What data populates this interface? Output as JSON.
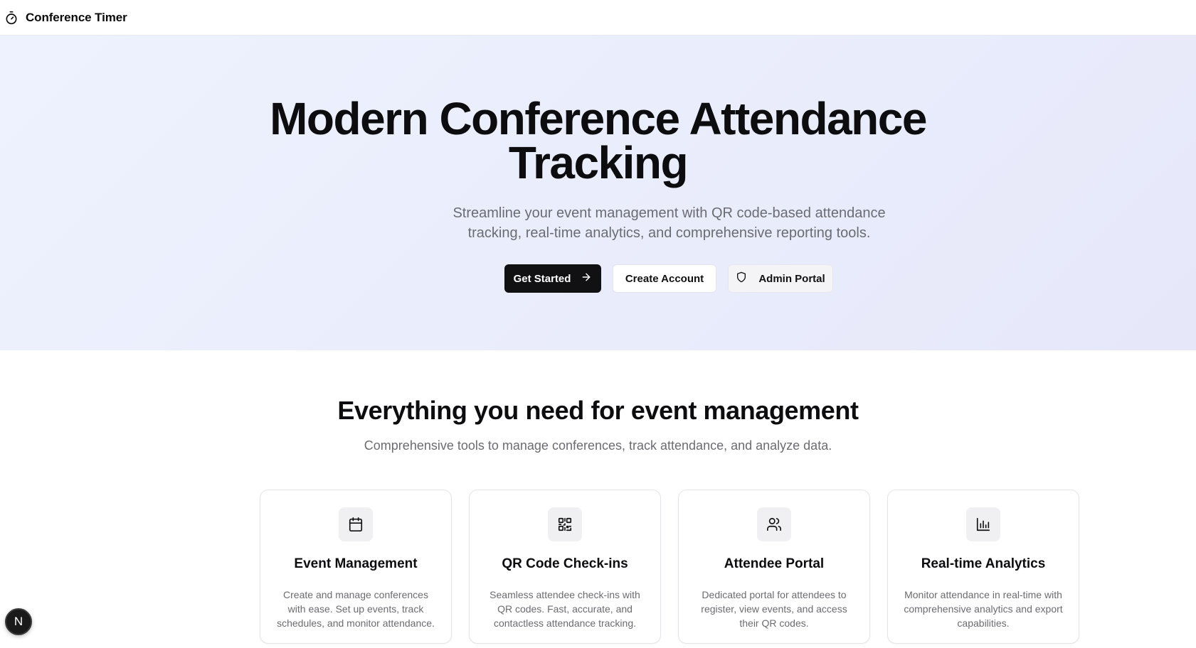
{
  "header": {
    "brand_icon": "stopwatch-icon",
    "brand_name": "Conference Timer"
  },
  "hero": {
    "title_line1": "Modern Conference Attendance",
    "title_line2": "Tracking",
    "subtitle_line1": "Streamline your event management with QR code-based attendance",
    "subtitle_line2": "tracking, real-time analytics, and comprehensive reporting tools.",
    "buttons": {
      "get_started": "Get Started",
      "create_account": "Create Account",
      "admin_portal": "Admin Portal"
    }
  },
  "features": {
    "title": "Everything you need for event management",
    "subtitle": "Comprehensive tools to manage conferences, track attendance, and analyze data.",
    "cards": [
      {
        "icon": "calendar-icon",
        "title": "Event Management",
        "desc": "Create and manage conferences with ease. Set up events, track schedules, and monitor attendance."
      },
      {
        "icon": "qr-code-icon",
        "title": "QR Code Check-ins",
        "desc": "Seamless attendee check-ins with QR codes. Fast, accurate, and contactless attendance tracking."
      },
      {
        "icon": "users-icon",
        "title": "Attendee Portal",
        "desc": "Dedicated portal for attendees to register, view events, and access their QR codes."
      },
      {
        "icon": "bar-chart-icon",
        "title": "Real-time Analytics",
        "desc": "Monitor attendance in real-time with comprehensive analytics and export capabilities."
      }
    ]
  },
  "dev_badge": {
    "letter": "N"
  },
  "colors": {
    "primary": "#111113",
    "hero_bg": "#eceffd",
    "muted_text": "#6b6b72",
    "border": "#e4e4ea"
  }
}
